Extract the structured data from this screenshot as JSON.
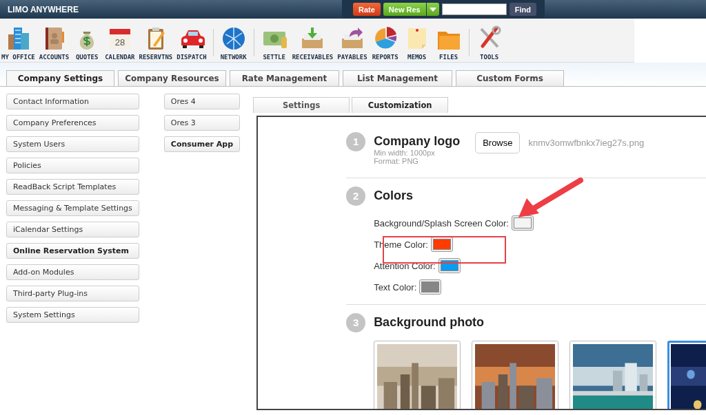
{
  "header": {
    "logo": "LIMO ANYWHERE",
    "rate_button": "Rate",
    "new_res_button": "New Res",
    "find_button": "Find"
  },
  "toolbar": [
    {
      "items": [
        {
          "label": "MY OFFICE"
        },
        {
          "label": "ACCOUNTS"
        },
        {
          "label": "QUOTES"
        },
        {
          "label": "CALENDAR",
          "icon_text": "28"
        },
        {
          "label": "RESERVTNS"
        },
        {
          "label": "DISPATCH"
        }
      ]
    },
    {
      "items": [
        {
          "label": "NETWORK"
        }
      ]
    },
    {
      "items": [
        {
          "label": "SETTLE"
        },
        {
          "label": "RECEIVABLES"
        },
        {
          "label": "PAYABLES"
        },
        {
          "label": "REPORTS"
        },
        {
          "label": "MEMOS"
        },
        {
          "label": "FILES"
        }
      ]
    },
    {
      "items": [
        {
          "label": "TOOLS"
        }
      ]
    }
  ],
  "tabs": [
    {
      "label": "Company Settings",
      "selected": true
    },
    {
      "label": "Company Resources",
      "selected": false
    },
    {
      "label": "Rate Management",
      "selected": false
    },
    {
      "label": "List Management",
      "selected": false
    },
    {
      "label": "Custom Forms",
      "selected": false
    }
  ],
  "sidebar": {
    "items": [
      {
        "label": "Contact Information",
        "selected": false
      },
      {
        "label": "Company Preferences",
        "selected": false
      },
      {
        "label": "System Users",
        "selected": false
      },
      {
        "label": "Policies",
        "selected": false
      },
      {
        "label": "ReadBack Script Templates",
        "selected": false
      },
      {
        "label": "Messaging & Template Settings",
        "selected": false
      },
      {
        "label": "iCalendar Settings",
        "selected": false
      },
      {
        "label": "Online Reservation System",
        "selected": true
      },
      {
        "label": "Add-on Modules",
        "selected": false
      },
      {
        "label": "Third-party Plug-ins",
        "selected": false
      },
      {
        "label": "System Settings",
        "selected": false
      }
    ]
  },
  "submenu": {
    "items": [
      {
        "label": "Ores 4",
        "selected": false
      },
      {
        "label": "Ores 3",
        "selected": false
      },
      {
        "label": "Consumer App",
        "selected": true
      }
    ]
  },
  "subtabs": [
    {
      "label": "Settings",
      "selected": false
    },
    {
      "label": "Customization",
      "selected": true
    }
  ],
  "sections": [
    {
      "number": "1",
      "title": "Company logo",
      "hints": [
        "Min width: 1000px",
        "Format: PNG"
      ],
      "browse_button": "Browse",
      "file_name": "knmv3omwfbnkx7ieg27s.png"
    },
    {
      "number": "2",
      "title": "Colors",
      "colors": [
        {
          "label": "Background/Splash Screen Color:",
          "color": "#f4f4f4"
        },
        {
          "label": "Theme Color:",
          "color": "#ff3c00"
        },
        {
          "label": "Attention Color:",
          "color": "#0a9cf0"
        },
        {
          "label": "Text Color:",
          "color": "#868686"
        }
      ]
    },
    {
      "number": "3",
      "title": "Background photo",
      "photos": [
        {
          "kind": "picture",
          "selected": false
        },
        {
          "kind": "picture",
          "selected": false
        },
        {
          "kind": "picture",
          "selected": false
        },
        {
          "kind": "picture",
          "selected": true
        }
      ]
    }
  ]
}
